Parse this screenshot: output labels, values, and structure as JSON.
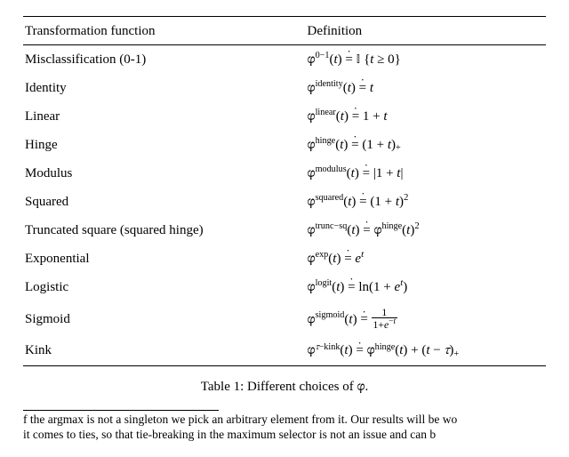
{
  "table": {
    "header": {
      "col1": "Transformation function",
      "col2": "Definition"
    },
    "rows": [
      {
        "name": "Misclassification (0-1)",
        "sup": "0−1",
        "body": "𝕀 {t ≥ 0}"
      },
      {
        "name": "Identity",
        "sup": "identity",
        "body": "t"
      },
      {
        "name": "Linear",
        "sup": "linear",
        "body": "1 + t"
      },
      {
        "name": "Hinge",
        "sup": "hinge",
        "body": "(1 + t)₊"
      },
      {
        "name": "Modulus",
        "sup": "modulus",
        "body": "|1 + t|"
      },
      {
        "name": "Squared",
        "sup": "squared",
        "body": "(1 + t)²"
      },
      {
        "name": "Truncated square (squared hinge)",
        "sup": "trunc−sq",
        "body": "φ hinge (t)²"
      },
      {
        "name": "Exponential",
        "sup": "exp",
        "body": "eᵗ"
      },
      {
        "name": "Logistic",
        "sup": "logit",
        "body": "ln(1 + eᵗ)"
      },
      {
        "name": "Sigmoid",
        "sup": "sigmoid",
        "body": "1 / (1 + e⁻ᵗ)"
      },
      {
        "name": "Kink",
        "sup": "τ−kink",
        "body": "φ hinge (t) + (t − τ)₊"
      }
    ]
  },
  "caption": "Table 1: Different choices of φ.",
  "footnote": {
    "line1": "f the argmax is not a singleton we pick an arbitrary element from it. Our results will be wo",
    "line2": " it comes to ties, so that tie-breaking in the maximum selector is not an issue and can b"
  }
}
